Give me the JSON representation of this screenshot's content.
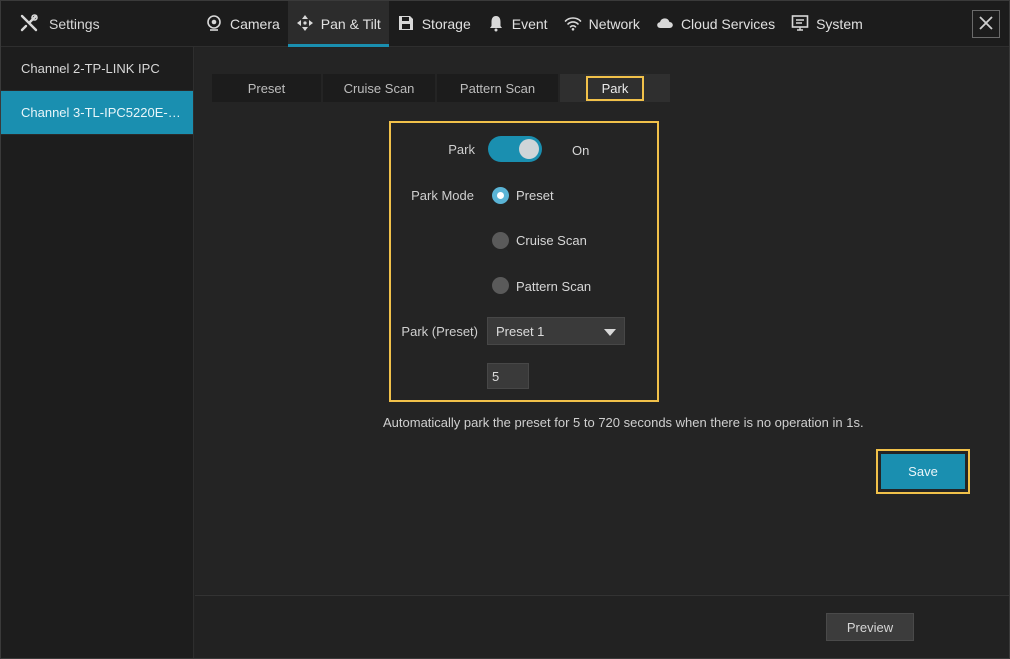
{
  "app": {
    "title": "Settings",
    "icon": "tools-icon"
  },
  "tabs": [
    {
      "label": "Camera",
      "icon": "camera-icon"
    },
    {
      "label": "Pan & Tilt",
      "icon": "pan-tilt-icon",
      "active": true
    },
    {
      "label": "Storage",
      "icon": "storage-icon"
    },
    {
      "label": "Event",
      "icon": "bell-icon"
    },
    {
      "label": "Network",
      "icon": "wifi-icon"
    },
    {
      "label": "Cloud Services",
      "icon": "cloud-icon"
    },
    {
      "label": "System",
      "icon": "monitor-icon"
    }
  ],
  "sidebar": {
    "items": [
      {
        "label": "Channel 2-TP-LINK IPC"
      },
      {
        "label": "Channel 3-TL-IPC5220E-DC...",
        "active": true
      }
    ]
  },
  "subtabs": [
    {
      "label": "Preset"
    },
    {
      "label": "Cruise Scan"
    },
    {
      "label": "Pattern Scan"
    },
    {
      "label": "Park",
      "active": true
    }
  ],
  "park": {
    "label": "Park",
    "toggle_state": "On",
    "mode_label": "Park Mode",
    "modes": [
      {
        "label": "Preset",
        "checked": true
      },
      {
        "label": "Cruise Scan",
        "checked": false
      },
      {
        "label": "Pattern Scan",
        "checked": false
      }
    ],
    "preset_label": "Park (Preset)",
    "preset_value": "Preset 1",
    "seconds_value": "5",
    "note": "Automatically park the preset for 5 to 720 seconds when there is no operation in 1s."
  },
  "buttons": {
    "save": "Save",
    "preview": "Preview"
  },
  "colors": {
    "accent": "#1a8fb0",
    "highlight": "#f1c14a",
    "background": "#242424"
  }
}
